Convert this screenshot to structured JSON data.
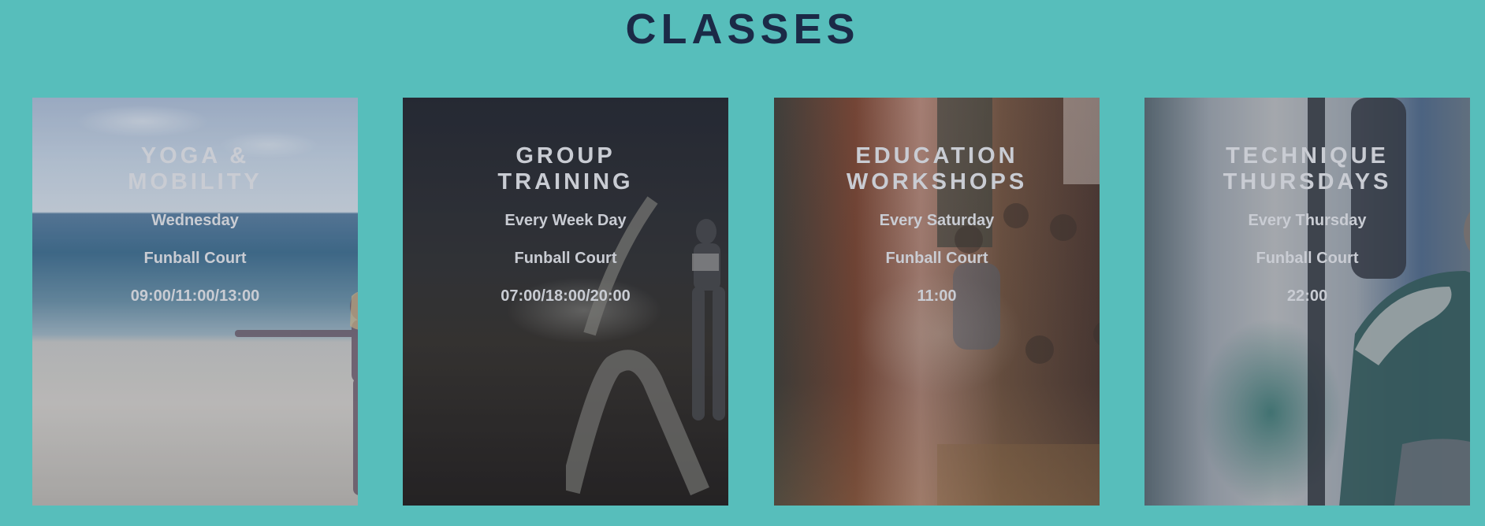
{
  "page": {
    "title": "CLASSES"
  },
  "classes": [
    {
      "title": "YOGA & MOBILITY",
      "schedule": "Wednesday",
      "location": "Funball Court",
      "times": "09:00/11:00/13:00"
    },
    {
      "title": "GROUP TRAINING",
      "schedule": "Every Week Day",
      "location": "Funball Court",
      "times": "07:00/18:00/20:00"
    },
    {
      "title": "EDUCATION WORKSHOPS",
      "schedule": "Every Saturday",
      "location": "Funball Court",
      "times": "11:00"
    },
    {
      "title": "TECHNIQUE THURSDAYS",
      "schedule": "Every Thursday",
      "location": "Funball Court",
      "times": "22:00"
    }
  ],
  "colors": {
    "page_background": "#57bebb",
    "title_text": "#1b2a47",
    "card_text": "#c9ccd3"
  }
}
